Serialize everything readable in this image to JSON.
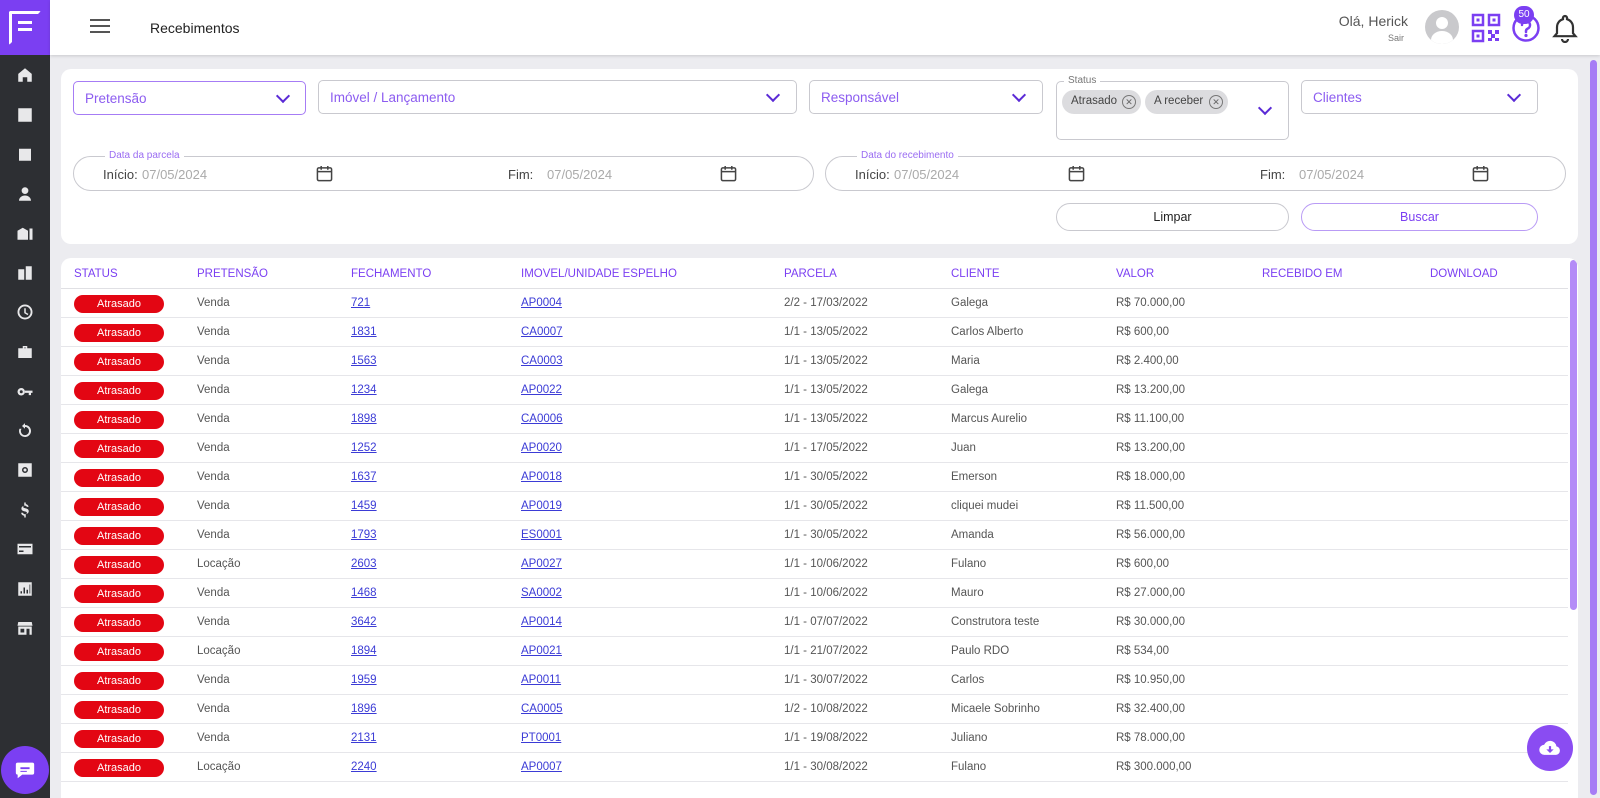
{
  "header": {
    "title": "Recebimentos",
    "greeting": "Olá, Herick",
    "logout": "Sair",
    "notification_count": "50"
  },
  "sidebar": {
    "icons": [
      "home-icon",
      "chart-line-icon",
      "calendar-icon",
      "person-icon",
      "building-icon",
      "city-icon",
      "clock-icon",
      "briefcase-icon",
      "key-icon",
      "refresh-icon",
      "settings-box-icon",
      "dollar-icon",
      "credit-card-icon",
      "bar-chart-icon",
      "store-icon"
    ]
  },
  "filters": {
    "pretensao": "Pretensão",
    "imovel": "Imóvel / Lançamento",
    "responsavel": "Responsável",
    "status_legend": "Status",
    "status_chips": [
      "Atrasado",
      "A receber"
    ],
    "clientes": "Clientes",
    "data_parcela_legend": "Data da parcela",
    "data_recebimento_legend": "Data do recebimento",
    "inicio_label": "Início:",
    "fim_label": "Fim:",
    "parcela_inicio": "07/05/2024",
    "parcela_fim": "07/05/2024",
    "recebimento_inicio": "07/05/2024",
    "recebimento_fim": "07/05/2024",
    "limpar": "Limpar",
    "buscar": "Buscar"
  },
  "table": {
    "headers": [
      "STATUS",
      "PRETENSÃO",
      "FECHAMENTO",
      "IMOVEL/UNIDADE ESPELHO",
      "PARCELA",
      "CLIENTE",
      "VALOR",
      "RECEBIDO EM",
      "DOWNLOAD"
    ],
    "rows": [
      {
        "status": "Atrasado",
        "pretensao": "Venda",
        "fechamento": "721",
        "imovel": "AP0004",
        "parcela": "2/2 - 17/03/2022",
        "cliente": "Galega",
        "valor": "R$ 70.000,00"
      },
      {
        "status": "Atrasado",
        "pretensao": "Venda",
        "fechamento": "1831",
        "imovel": "CA0007",
        "parcela": "1/1 - 13/05/2022",
        "cliente": "Carlos Alberto",
        "valor": "R$ 600,00"
      },
      {
        "status": "Atrasado",
        "pretensao": "Venda",
        "fechamento": "1563",
        "imovel": "CA0003",
        "parcela": "1/1 - 13/05/2022",
        "cliente": "Maria",
        "valor": "R$ 2.400,00"
      },
      {
        "status": "Atrasado",
        "pretensao": "Venda",
        "fechamento": "1234",
        "imovel": "AP0022",
        "parcela": "1/1 - 13/05/2022",
        "cliente": "Galega",
        "valor": "R$ 13.200,00"
      },
      {
        "status": "Atrasado",
        "pretensao": "Venda",
        "fechamento": "1898",
        "imovel": "CA0006",
        "parcela": "1/1 - 13/05/2022",
        "cliente": "Marcus Aurelio",
        "valor": "R$ 11.100,00"
      },
      {
        "status": "Atrasado",
        "pretensao": "Venda",
        "fechamento": "1252",
        "imovel": "AP0020",
        "parcela": "1/1 - 17/05/2022",
        "cliente": "Juan",
        "valor": "R$ 13.200,00"
      },
      {
        "status": "Atrasado",
        "pretensao": "Venda",
        "fechamento": "1637",
        "imovel": "AP0018",
        "parcela": "1/1 - 30/05/2022",
        "cliente": "Emerson",
        "valor": "R$ 18.000,00"
      },
      {
        "status": "Atrasado",
        "pretensao": "Venda",
        "fechamento": "1459",
        "imovel": "AP0019",
        "parcela": "1/1 - 30/05/2022",
        "cliente": "cliquei mudei",
        "valor": "R$ 11.500,00"
      },
      {
        "status": "Atrasado",
        "pretensao": "Venda",
        "fechamento": "1793",
        "imovel": "ES0001",
        "parcela": "1/1 - 30/05/2022",
        "cliente": "Amanda",
        "valor": "R$ 56.000,00"
      },
      {
        "status": "Atrasado",
        "pretensao": "Locação",
        "fechamento": "2603",
        "imovel": "AP0027",
        "parcela": "1/1 - 10/06/2022",
        "cliente": "Fulano",
        "valor": "R$ 600,00"
      },
      {
        "status": "Atrasado",
        "pretensao": "Venda",
        "fechamento": "1468",
        "imovel": "SA0002",
        "parcela": "1/1 - 10/06/2022",
        "cliente": "Mauro",
        "valor": "R$ 27.000,00"
      },
      {
        "status": "Atrasado",
        "pretensao": "Venda",
        "fechamento": "3642",
        "imovel": "AP0014",
        "parcela": "1/1 - 07/07/2022",
        "cliente": "Construtora teste",
        "valor": "R$ 30.000,00"
      },
      {
        "status": "Atrasado",
        "pretensao": "Locação",
        "fechamento": "1894",
        "imovel": "AP0021",
        "parcela": "1/1 - 21/07/2022",
        "cliente": "Paulo RDO",
        "valor": "R$ 534,00"
      },
      {
        "status": "Atrasado",
        "pretensao": "Venda",
        "fechamento": "1959",
        "imovel": "AP0011",
        "parcela": "1/1 - 30/07/2022",
        "cliente": "Carlos",
        "valor": "R$ 10.950,00"
      },
      {
        "status": "Atrasado",
        "pretensao": "Venda",
        "fechamento": "1896",
        "imovel": "CA0005",
        "parcela": "1/2 - 10/08/2022",
        "cliente": "Micaele Sobrinho",
        "valor": "R$ 32.400,00"
      },
      {
        "status": "Atrasado",
        "pretensao": "Venda",
        "fechamento": "2131",
        "imovel": "PT0001",
        "parcela": "1/1 - 19/08/2022",
        "cliente": "Juliano",
        "valor": "R$ 78.000,00"
      },
      {
        "status": "Atrasado",
        "pretensao": "Locação",
        "fechamento": "2240",
        "imovel": "AP0007",
        "parcela": "1/1 - 30/08/2022",
        "cliente": "Fulano",
        "valor": "R$ 300.000,00"
      }
    ]
  },
  "colors": {
    "accent": "#7b3ff2",
    "sidebar": "#2d2f33",
    "status_late": "#e30613"
  }
}
